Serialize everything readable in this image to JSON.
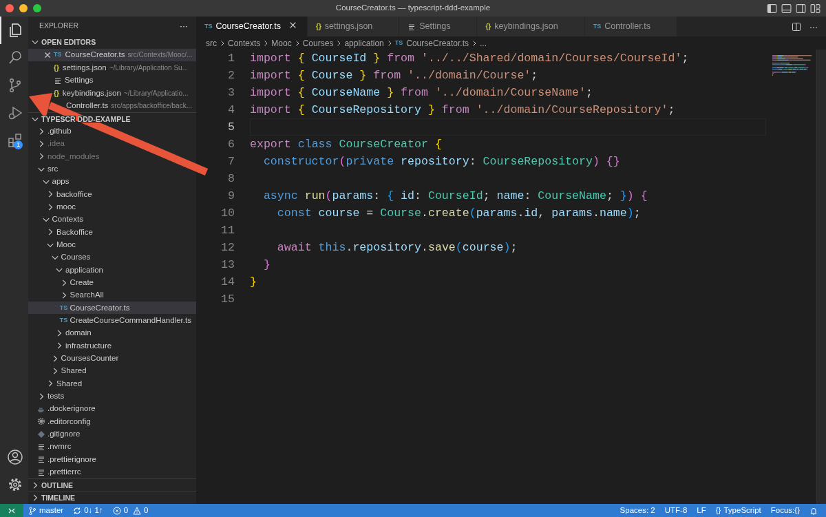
{
  "window": {
    "title": "CourseCreator.ts — typescript-ddd-example"
  },
  "activity_bar": {
    "items": [
      {
        "kind": "files",
        "selected": true
      },
      {
        "kind": "search",
        "selected": false
      },
      {
        "kind": "source-control",
        "selected": false
      },
      {
        "kind": "run-debug",
        "selected": false
      },
      {
        "kind": "extensions",
        "selected": false,
        "badge": "1"
      }
    ],
    "bottom": [
      {
        "kind": "account"
      },
      {
        "kind": "settings"
      }
    ]
  },
  "sidebar": {
    "title": "EXPLORER",
    "more": "···",
    "open_editors": {
      "title": "OPEN EDITORS",
      "expanded": true,
      "items": [
        {
          "name": "CourseCreator.ts",
          "path": "src/Contexts/Mooc/...",
          "kind": "ts",
          "glyph": "TS",
          "selected": true,
          "show_close": true
        },
        {
          "name": "settings.json",
          "path": "~/Library/Application Su...",
          "kind": "json",
          "glyph": "{}",
          "selected": false,
          "show_close": false
        },
        {
          "name": "Settings",
          "kind": "lines",
          "selected": false,
          "show_close": false
        },
        {
          "name": "keybindings.json",
          "path": "~/Library/Applicatio...",
          "kind": "json",
          "glyph": "{}",
          "selected": false,
          "show_close": false
        },
        {
          "name": "Controller.ts",
          "path": "src/apps/backoffice/back...",
          "kind": "ts",
          "selected": false,
          "show_close": false
        }
      ]
    },
    "project": {
      "title": [
        "TYPESCR",
        "DDD-EXAMPLE"
      ],
      "expanded": true,
      "tree": [
        {
          "name": ".github",
          "kind": "folder",
          "expanded": false,
          "dimmed": false,
          "selected": false
        },
        {
          "name": ".idea",
          "kind": "folder",
          "expanded": false,
          "dimmed": true,
          "selected": false
        },
        {
          "name": "node_modules",
          "kind": "folder",
          "expanded": false,
          "dimmed": true,
          "selected": false
        },
        {
          "name": "src",
          "kind": "folder",
          "expanded": true,
          "dimmed": false,
          "selected": false,
          "children": [
            {
              "name": "apps",
              "kind": "folder",
              "expanded": true,
              "dimmed": false,
              "selected": false,
              "children": [
                {
                  "name": "backoffice",
                  "kind": "folder",
                  "expanded": false,
                  "dimmed": false,
                  "selected": false
                },
                {
                  "name": "mooc",
                  "kind": "folder",
                  "expanded": false,
                  "dimmed": false,
                  "selected": false
                }
              ]
            },
            {
              "name": "Contexts",
              "kind": "folder",
              "expanded": true,
              "dimmed": false,
              "selected": false,
              "children": [
                {
                  "name": "Backoffice",
                  "kind": "folder",
                  "expanded": false,
                  "dimmed": false,
                  "selected": false
                },
                {
                  "name": "Mooc",
                  "kind": "folder",
                  "expanded": true,
                  "dimmed": false,
                  "selected": false,
                  "children": [
                    {
                      "name": "Courses",
                      "kind": "folder",
                      "expanded": true,
                      "dimmed": false,
                      "selected": false,
                      "children": [
                        {
                          "name": "application",
                          "kind": "folder",
                          "expanded": true,
                          "dimmed": false,
                          "selected": false,
                          "children": [
                            {
                              "name": "Create",
                              "kind": "folder",
                              "expanded": false,
                              "dimmed": false,
                              "selected": false
                            },
                            {
                              "name": "SearchAll",
                              "kind": "folder",
                              "expanded": false,
                              "dimmed": false,
                              "selected": false
                            },
                            {
                              "name": "CourseCreator.ts",
                              "kind": "ts",
                              "glyph": "TS",
                              "dimmed": false,
                              "selected": true
                            },
                            {
                              "name": "CreateCourseCommandHandler.ts",
                              "kind": "ts",
                              "glyph": "TS",
                              "dimmed": false,
                              "selected": false
                            }
                          ]
                        },
                        {
                          "name": "domain",
                          "kind": "folder",
                          "expanded": false,
                          "dimmed": false,
                          "selected": false
                        },
                        {
                          "name": "infrastructure",
                          "kind": "folder",
                          "expanded": false,
                          "dimmed": false,
                          "selected": false
                        }
                      ]
                    },
                    {
                      "name": "CoursesCounter",
                      "kind": "folder",
                      "expanded": false,
                      "dimmed": false,
                      "selected": false
                    },
                    {
                      "name": "Shared",
                      "kind": "folder",
                      "expanded": false,
                      "dimmed": false,
                      "selected": false
                    }
                  ]
                },
                {
                  "name": "Shared",
                  "kind": "folder",
                  "expanded": false,
                  "dimmed": false,
                  "selected": false
                }
              ]
            }
          ]
        },
        {
          "name": "tests",
          "kind": "folder",
          "expanded": false,
          "dimmed": false,
          "selected": false
        },
        {
          "name": ".dockerignore",
          "kind": "docker",
          "dimmed": false,
          "selected": false
        },
        {
          "name": ".editorconfig",
          "kind": "gear",
          "dimmed": false,
          "selected": false
        },
        {
          "name": ".gitignore",
          "kind": "git",
          "dimmed": false,
          "selected": false
        },
        {
          "name": ".nvmrc",
          "kind": "lines",
          "dimmed": false,
          "selected": false
        },
        {
          "name": ".prettierignore",
          "kind": "lines",
          "dimmed": false,
          "selected": false
        },
        {
          "name": ".prettierrc",
          "kind": "lines",
          "dimmed": false,
          "selected": false
        }
      ]
    },
    "outline": {
      "title": "OUTLINE",
      "expanded": false
    },
    "timeline": {
      "title": "TIMELINE",
      "expanded": false
    }
  },
  "tabs": [
    {
      "label": "CourseCreator.ts",
      "kind": "ts",
      "glyph": "TS",
      "selected": true
    },
    {
      "label": "settings.json",
      "kind": "json",
      "glyph": "{}",
      "selected": false
    },
    {
      "label": "Settings",
      "kind": "lines",
      "selected": false
    },
    {
      "label": "keybindings.json",
      "kind": "json",
      "glyph": "{}",
      "selected": false
    },
    {
      "label": "Controller.ts",
      "kind": "ts",
      "glyph": "TS",
      "selected": false
    }
  ],
  "editor_actions": {
    "more": "···"
  },
  "breadcrumbs": [
    {
      "label": "src"
    },
    {
      "label": "Contexts"
    },
    {
      "label": "Mooc"
    },
    {
      "label": "Courses"
    },
    {
      "label": "application"
    },
    {
      "label": "CourseCreator.ts",
      "glyph": "TS"
    },
    {
      "label": "..."
    }
  ],
  "code": [
    {
      "number": "1",
      "current": false,
      "tokens": [
        {
          "kind": "kw",
          "text": "import "
        },
        {
          "kind": "b1",
          "text": "{"
        },
        {
          "kind": "var",
          "text": " CourseId "
        },
        {
          "kind": "b1",
          "text": "}"
        },
        {
          "kind": "kw",
          "text": " from "
        },
        {
          "kind": "str",
          "text": "'../../Shared/domain/Courses/CourseId'"
        },
        {
          "kind": "p",
          "text": ";"
        }
      ]
    },
    {
      "number": "2",
      "current": false,
      "tokens": [
        {
          "kind": "kw",
          "text": "import "
        },
        {
          "kind": "b1",
          "text": "{"
        },
        {
          "kind": "var",
          "text": " Course "
        },
        {
          "kind": "b1",
          "text": "}"
        },
        {
          "kind": "kw",
          "text": " from "
        },
        {
          "kind": "str",
          "text": "'../domain/Course'"
        },
        {
          "kind": "p",
          "text": ";"
        }
      ]
    },
    {
      "number": "3",
      "current": false,
      "tokens": [
        {
          "kind": "kw",
          "text": "import "
        },
        {
          "kind": "b1",
          "text": "{"
        },
        {
          "kind": "var",
          "text": " CourseName "
        },
        {
          "kind": "b1",
          "text": "}"
        },
        {
          "kind": "kw",
          "text": " from "
        },
        {
          "kind": "str",
          "text": "'../domain/CourseName'"
        },
        {
          "kind": "p",
          "text": ";"
        }
      ]
    },
    {
      "number": "4",
      "current": false,
      "tokens": [
        {
          "kind": "kw",
          "text": "import "
        },
        {
          "kind": "b1",
          "text": "{"
        },
        {
          "kind": "var",
          "text": " CourseRepository "
        },
        {
          "kind": "b1",
          "text": "}"
        },
        {
          "kind": "kw",
          "text": " from "
        },
        {
          "kind": "str",
          "text": "'../domain/CourseRepository'"
        },
        {
          "kind": "p",
          "text": ";"
        }
      ]
    },
    {
      "number": "5",
      "current": true
    },
    {
      "number": "6",
      "current": false,
      "tokens": [
        {
          "kind": "kw",
          "text": "export "
        },
        {
          "kind": "st",
          "text": "class "
        },
        {
          "kind": "type",
          "text": "CourseCreator "
        },
        {
          "kind": "b1",
          "text": "{"
        }
      ]
    },
    {
      "number": "7",
      "current": false,
      "tokens": [
        {
          "kind": "st",
          "text": "  constructor"
        },
        {
          "kind": "b2",
          "text": "("
        },
        {
          "kind": "st",
          "text": "private "
        },
        {
          "kind": "var",
          "text": "repository"
        },
        {
          "kind": "p",
          "text": ": "
        },
        {
          "kind": "type",
          "text": "CourseRepository"
        },
        {
          "kind": "b2",
          "text": ")"
        },
        {
          "kind": "b2",
          "text": " {}"
        }
      ]
    },
    {
      "number": "8",
      "current": false
    },
    {
      "number": "9",
      "current": false,
      "tokens": [
        {
          "kind": "st",
          "text": "  async "
        },
        {
          "kind": "fn",
          "text": "run"
        },
        {
          "kind": "b2",
          "text": "("
        },
        {
          "kind": "var",
          "text": "params"
        },
        {
          "kind": "p",
          "text": ": "
        },
        {
          "kind": "b3",
          "text": "{"
        },
        {
          "kind": "var",
          "text": " id"
        },
        {
          "kind": "p",
          "text": ": "
        },
        {
          "kind": "type",
          "text": "CourseId"
        },
        {
          "kind": "p",
          "text": "; "
        },
        {
          "kind": "var",
          "text": "name"
        },
        {
          "kind": "p",
          "text": ": "
        },
        {
          "kind": "type",
          "text": "CourseName"
        },
        {
          "kind": "p",
          "text": "; "
        },
        {
          "kind": "b3",
          "text": "}"
        },
        {
          "kind": "b2",
          "text": ")"
        },
        {
          "kind": "b2",
          "text": " {"
        }
      ]
    },
    {
      "number": "10",
      "current": false,
      "tokens": [
        {
          "kind": "st",
          "text": "    const "
        },
        {
          "kind": "var",
          "text": "course"
        },
        {
          "kind": "p",
          "text": " = "
        },
        {
          "kind": "type",
          "text": "Course"
        },
        {
          "kind": "p",
          "text": "."
        },
        {
          "kind": "fn",
          "text": "create"
        },
        {
          "kind": "b3",
          "text": "("
        },
        {
          "kind": "var",
          "text": "params"
        },
        {
          "kind": "p",
          "text": "."
        },
        {
          "kind": "var",
          "text": "id"
        },
        {
          "kind": "p",
          "text": ", "
        },
        {
          "kind": "var",
          "text": "params"
        },
        {
          "kind": "p",
          "text": "."
        },
        {
          "kind": "var",
          "text": "name"
        },
        {
          "kind": "b3",
          "text": ")"
        },
        {
          "kind": "p",
          "text": ";"
        }
      ]
    },
    {
      "number": "11",
      "current": false
    },
    {
      "number": "12",
      "current": false,
      "tokens": [
        {
          "kind": "kw",
          "text": "    await "
        },
        {
          "kind": "st",
          "text": "this"
        },
        {
          "kind": "p",
          "text": "."
        },
        {
          "kind": "var",
          "text": "repository"
        },
        {
          "kind": "p",
          "text": "."
        },
        {
          "kind": "fn",
          "text": "save"
        },
        {
          "kind": "b3",
          "text": "("
        },
        {
          "kind": "var",
          "text": "course"
        },
        {
          "kind": "b3",
          "text": ")"
        },
        {
          "kind": "p",
          "text": ";"
        }
      ]
    },
    {
      "number": "13",
      "current": false,
      "tokens": [
        {
          "kind": "b2",
          "text": "  }"
        }
      ]
    },
    {
      "number": "14",
      "current": false,
      "tokens": [
        {
          "kind": "b1",
          "text": "}"
        }
      ]
    },
    {
      "number": "15",
      "current": false
    }
  ],
  "status_bar": {
    "left": [
      {
        "kind": "remote"
      },
      {
        "kind": "branch",
        "text": "master"
      },
      {
        "kind": "sync",
        "text": "0↓ 1↑"
      },
      {
        "kind": "errors",
        "text": "0"
      },
      {
        "kind": "warnings",
        "text": "0"
      }
    ],
    "right": [
      {
        "kind": "text",
        "text": "Spaces: 2"
      },
      {
        "kind": "text",
        "text": "UTF-8"
      },
      {
        "kind": "text",
        "text": "LF"
      },
      {
        "kind": "language",
        "glyph": "{}",
        "text": "TypeScript"
      },
      {
        "kind": "text",
        "text": "Focus:{}"
      },
      {
        "kind": "bell"
      }
    ]
  }
}
